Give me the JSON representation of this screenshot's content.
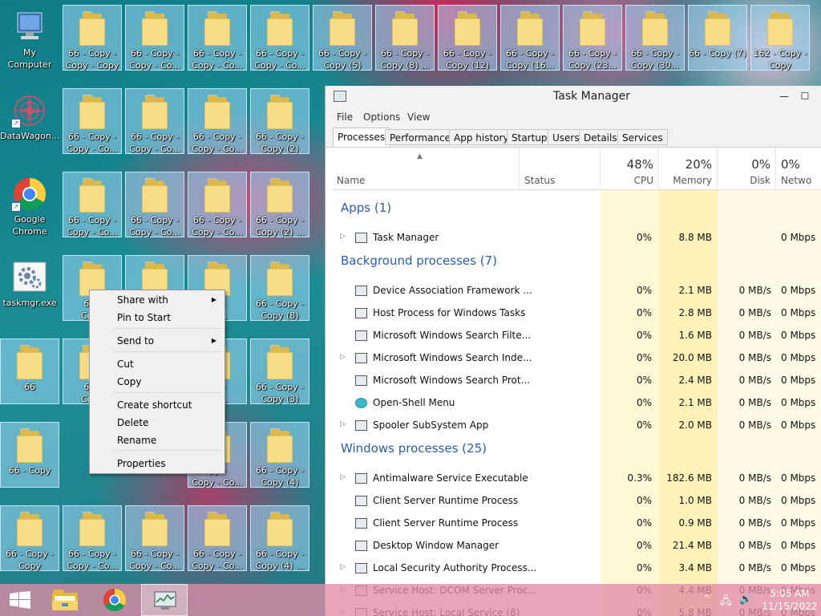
{
  "desktop": {
    "icons": [
      {
        "label": "My Computer",
        "type": "computer",
        "col": 0,
        "row": 0
      },
      {
        "label": "66 - Copy -\nCopy - Copy",
        "type": "folder",
        "col": 1,
        "row": 0
      },
      {
        "label": "66 - Copy -\nCopy - Co...",
        "type": "folder",
        "col": 2,
        "row": 0
      },
      {
        "label": "66 - Copy -\nCopy - Co...",
        "type": "folder",
        "col": 3,
        "row": 0
      },
      {
        "label": "66 - Copy -\nCopy - Co...",
        "type": "folder",
        "col": 4,
        "row": 0
      },
      {
        "label": "66 - Copy -\nCopy (5)",
        "type": "folder",
        "col": 5,
        "row": 0
      },
      {
        "label": "66 - Copy -\nCopy (8) ...",
        "type": "folder",
        "col": 6,
        "row": 0
      },
      {
        "label": "66 - Copy -\nCopy (12)",
        "type": "folder",
        "col": 7,
        "row": 0
      },
      {
        "label": "66 - Copy -\nCopy (16...",
        "type": "folder",
        "col": 8,
        "row": 0
      },
      {
        "label": "66 - Copy -\nCopy (23...",
        "type": "folder",
        "col": 9,
        "row": 0
      },
      {
        "label": "66 - Copy -\nCopy (30...",
        "type": "folder",
        "col": 10,
        "row": 0
      },
      {
        "label": "66 - Copy (7)",
        "type": "folder",
        "col": 11,
        "row": 0
      },
      {
        "label": "162 - Copy -\nCopy",
        "type": "folder",
        "col": 12,
        "row": 0
      },
      {
        "label": "DataWagon...",
        "type": "datawagon",
        "col": 0,
        "row": 1
      },
      {
        "label": "66 - Copy -\nCopy - Co...",
        "type": "folder",
        "col": 1,
        "row": 1
      },
      {
        "label": "66 - Copy -\nCopy - Co...",
        "type": "folder",
        "col": 2,
        "row": 1
      },
      {
        "label": "66 - Copy -\nCopy - Co...",
        "type": "folder",
        "col": 3,
        "row": 1
      },
      {
        "label": "66 - Copy -\nCopy (2)",
        "type": "folder",
        "col": 4,
        "row": 1
      },
      {
        "label": "Google\nChrome",
        "type": "chrome",
        "col": 0,
        "row": 2
      },
      {
        "label": "66 - Copy -\nCopy - Co...",
        "type": "folder",
        "col": 1,
        "row": 2
      },
      {
        "label": "66 - Copy -\nCopy - Co...",
        "type": "folder",
        "col": 2,
        "row": 2
      },
      {
        "label": "66 - Copy -\nCopy - Co...",
        "type": "folder",
        "col": 3,
        "row": 2
      },
      {
        "label": "66 - Copy -\nCopy (2) ...",
        "type": "folder",
        "col": 4,
        "row": 2
      },
      {
        "label": "taskmgr.exe",
        "type": "taskmgr",
        "col": 0,
        "row": 3
      },
      {
        "label": "66 -\nCopy",
        "type": "folder",
        "col": 1,
        "row": 3
      },
      {
        "label": "",
        "type": "folder",
        "col": 2,
        "row": 3
      },
      {
        "label": "py -\nCo...",
        "type": "folder",
        "col": 3,
        "row": 3
      },
      {
        "label": "66 - Copy -\nCopy (8)",
        "type": "folder",
        "col": 4,
        "row": 3
      },
      {
        "label": "66",
        "type": "folder",
        "col": 0,
        "row": 4
      },
      {
        "label": "66 -\nCopy",
        "type": "folder",
        "col": 1,
        "row": 4
      },
      {
        "label": "py -\nCo...",
        "type": "folder",
        "col": 3,
        "row": 4
      },
      {
        "label": "66 - Copy -\nCopy (3)",
        "type": "folder",
        "col": 4,
        "row": 4
      },
      {
        "label": "66 - Copy",
        "type": "folder",
        "col": 0,
        "row": 5
      },
      {
        "label": "py -\nCopy - Co...",
        "type": "folder",
        "col": 3,
        "row": 5
      },
      {
        "label": "66 - Copy -\nCopy (4)",
        "type": "folder",
        "col": 4,
        "row": 5
      },
      {
        "label": "66 - Copy -\nCopy",
        "type": "folder",
        "col": 0,
        "row": 6
      },
      {
        "label": "66 - Copy -\nCopy - Co...",
        "type": "folder",
        "col": 1,
        "row": 6
      },
      {
        "label": "66 - Copy -\nCopy - Co...",
        "type": "folder",
        "col": 2,
        "row": 6
      },
      {
        "label": "66 - Copy -\nCopy - Co...",
        "type": "folder",
        "col": 3,
        "row": 6
      },
      {
        "label": "66 - Copy -\nCopy (4) ...",
        "type": "folder",
        "col": 4,
        "row": 6
      }
    ]
  },
  "context_menu": {
    "items": [
      {
        "label": "Share with",
        "submenu": true
      },
      {
        "label": "Pin to Start",
        "submenu": false
      },
      {
        "label": "Send to",
        "submenu": true
      },
      {
        "label": "Cut",
        "submenu": false
      },
      {
        "label": "Copy",
        "submenu": false
      },
      {
        "label": "Create shortcut",
        "submenu": false
      },
      {
        "label": "Delete",
        "submenu": false
      },
      {
        "label": "Rename",
        "submenu": false
      },
      {
        "label": "Properties",
        "submenu": false
      }
    ]
  },
  "task_manager": {
    "title": "Task Manager",
    "minimize_glyph": "—",
    "maximize_glyph": "☐",
    "menu": [
      "File",
      "Options",
      "View"
    ],
    "tabs": [
      "Processes",
      "Performance",
      "App history",
      "Startup",
      "Users",
      "Details",
      "Services"
    ],
    "active_tab": "Processes",
    "columns": {
      "name": "Name",
      "status": "Status",
      "cpu": {
        "pct": "48%",
        "label": "CPU"
      },
      "memory": {
        "pct": "20%",
        "label": "Memory"
      },
      "disk": {
        "pct": "0%",
        "label": "Disk"
      },
      "network": {
        "pct": "0%",
        "label": "Netwo"
      }
    },
    "groups": [
      {
        "title": "Apps (1)",
        "rows": [
          {
            "name": "Task Manager",
            "expand": true,
            "cpu": "0%",
            "mem": "8.8 MB",
            "disk": "",
            "net": "0 Mbps"
          }
        ]
      },
      {
        "title": "Background processes (7)",
        "rows": [
          {
            "name": "Device Association Framework ...",
            "expand": false,
            "cpu": "0%",
            "mem": "2.1 MB",
            "disk": "0 MB/s",
            "net": "0 Mbps"
          },
          {
            "name": "Host Process for Windows Tasks",
            "expand": false,
            "cpu": "0%",
            "mem": "2.8 MB",
            "disk": "0 MB/s",
            "net": "0 Mbps"
          },
          {
            "name": "Microsoft Windows Search Filte...",
            "expand": false,
            "cpu": "0%",
            "mem": "1.6 MB",
            "disk": "0 MB/s",
            "net": "0 Mbps"
          },
          {
            "name": "Microsoft Windows Search Inde...",
            "expand": true,
            "cpu": "0%",
            "mem": "20.0 MB",
            "disk": "0 MB/s",
            "net": "0 Mbps"
          },
          {
            "name": "Microsoft Windows Search Prot...",
            "expand": false,
            "cpu": "0%",
            "mem": "2.4 MB",
            "disk": "0 MB/s",
            "net": "0 Mbps"
          },
          {
            "name": "Open-Shell Menu",
            "expand": false,
            "cpu": "0%",
            "mem": "2.1 MB",
            "disk": "0 MB/s",
            "net": "0 Mbps"
          },
          {
            "name": "Spooler SubSystem App",
            "expand": true,
            "cpu": "0%",
            "mem": "2.0 MB",
            "disk": "0 MB/s",
            "net": "0 Mbps"
          }
        ]
      },
      {
        "title": "Windows processes (25)",
        "rows": [
          {
            "name": "Antimalware Service Executable",
            "expand": true,
            "cpu": "0.3%",
            "mem": "182.6 MB",
            "disk": "0 MB/s",
            "net": "0 Mbps"
          },
          {
            "name": "Client Server Runtime Process",
            "expand": false,
            "cpu": "0%",
            "mem": "1.0 MB",
            "disk": "0 MB/s",
            "net": "0 Mbps"
          },
          {
            "name": "Client Server Runtime Process",
            "expand": false,
            "cpu": "0%",
            "mem": "0.9 MB",
            "disk": "0 MB/s",
            "net": "0 Mbps"
          },
          {
            "name": "Desktop Window Manager",
            "expand": false,
            "cpu": "0%",
            "mem": "21.4 MB",
            "disk": "0 MB/s",
            "net": "0 Mbps"
          },
          {
            "name": "Local Security Authority Process...",
            "expand": true,
            "cpu": "0%",
            "mem": "3.4 MB",
            "disk": "0 MB/s",
            "net": "0 Mbps"
          },
          {
            "name": "Service Host: DCOM Server Proc...",
            "expand": true,
            "cpu": "0%",
            "mem": "4.4 MB",
            "disk": "0 MB/s",
            "net": "0 Mbps"
          },
          {
            "name": "Service Host: Local Service (8)",
            "expand": true,
            "cpu": "0%",
            "mem": "5.8 MB",
            "disk": "0 MB/s",
            "net": "0 Mbps"
          }
        ]
      }
    ]
  },
  "taskbar": {
    "clock_time": "5:05 AM",
    "clock_date": "11/15/2022",
    "start_icon": "windows-logo-icon",
    "pinned": [
      "file-explorer-icon",
      "chrome-icon",
      "task-manager-icon"
    ]
  },
  "colors": {
    "accent_blue": "#2a5fa8",
    "cpu_highlight": "#fff9d6",
    "mem_highlight": "#fff2b8",
    "taskbar": "#e18ca5"
  }
}
